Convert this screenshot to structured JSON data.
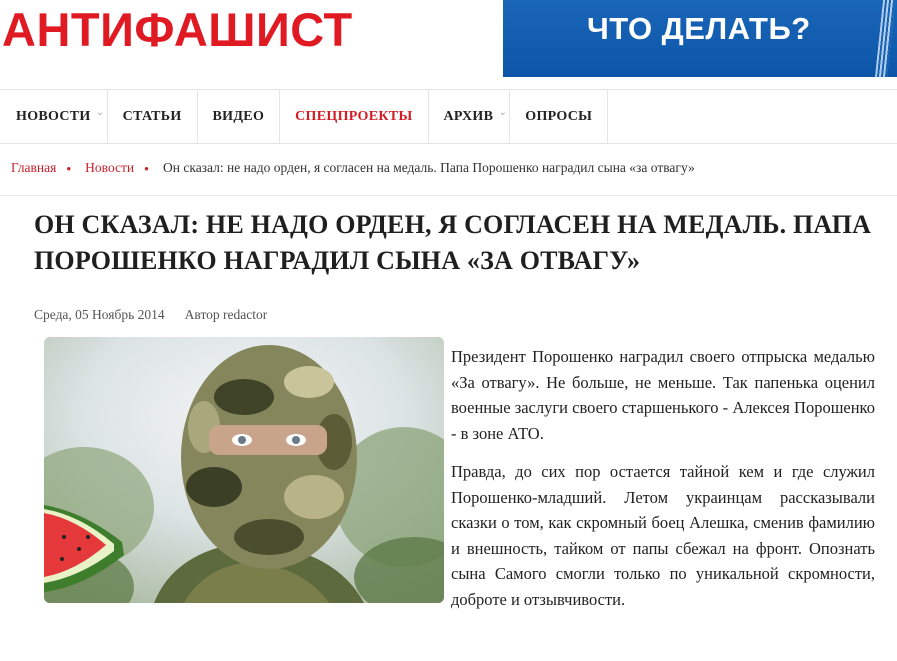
{
  "header": {
    "logo": "АНТИФАШИСТ",
    "banner_text": "ЧТО ДЕЛАТЬ?"
  },
  "nav": {
    "items": [
      {
        "label": "НОВОСТИ",
        "has_dropdown": true
      },
      {
        "label": "СТАТЬИ",
        "has_dropdown": false
      },
      {
        "label": "ВИДЕО",
        "has_dropdown": false
      },
      {
        "label": "СПЕЦПРОЕКТЫ",
        "has_dropdown": false,
        "active": true
      },
      {
        "label": "АРХИВ",
        "has_dropdown": true
      },
      {
        "label": "ОПРОСЫ",
        "has_dropdown": false
      }
    ]
  },
  "breadcrumb": {
    "home": "Главная",
    "section": "Новости",
    "current": "Он сказал: не надо орден, я согласен на медаль. Папа Порошенко наградил сына «за отвагу»"
  },
  "article": {
    "title": "Он сказал: не надо орден, я согласен на медаль. Папа Порошенко наградил сына «за отвагу»",
    "date": "Среда, 05 Ноябрь 2014",
    "author": "Автор redactor",
    "paragraphs": [
      "Президент Порошенко наградил своего отпрыска медалью «За отвагу». Не больше, не меньше. Так папенька оценил военные заслуги своего старшенького - Алексея Порошенко - в зоне АТО.",
      "Правда, до сих пор остается тайной кем и где служил Порошенко-младший. Летом украинцам рассказывали сказки о том, как скромный боец Алешка, сменив фамилию и внешность, тайком от папы сбежал на фронт. Опознать сына Самого смогли только по уникальной скромности, доброте и отзывчивости."
    ]
  },
  "colors": {
    "brand_red": "#e01a22",
    "banner_blue": "#0c55a8",
    "link_red": "#c9212a"
  }
}
